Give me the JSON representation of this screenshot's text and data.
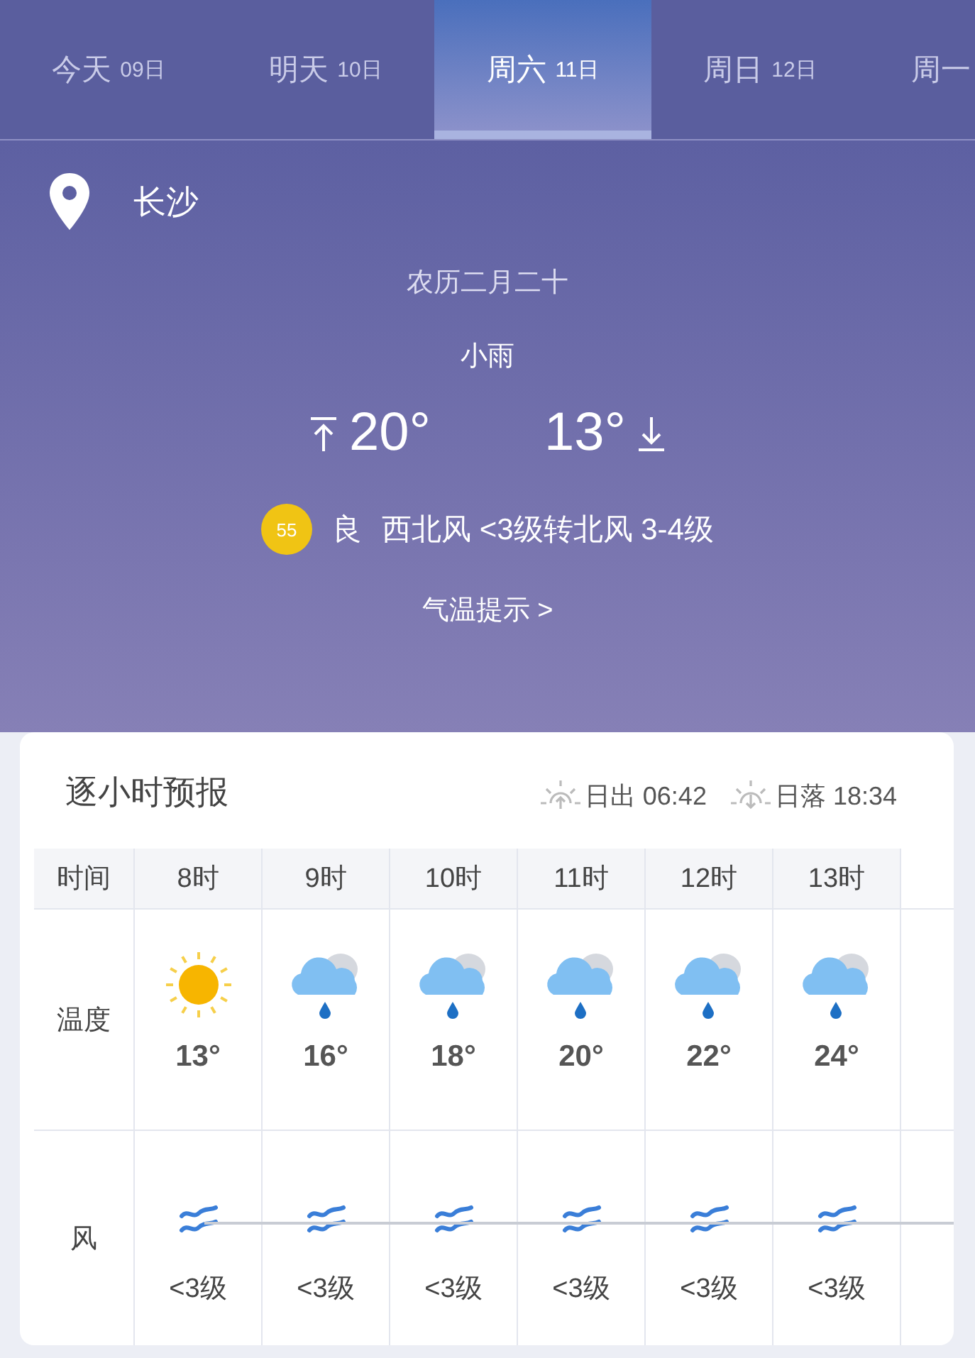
{
  "tabs": [
    {
      "day": "今天",
      "date": "09日",
      "selected": false
    },
    {
      "day": "明天",
      "date": "10日",
      "selected": false
    },
    {
      "day": "周六",
      "date": "11日",
      "selected": true
    },
    {
      "day": "周日",
      "date": "12日",
      "selected": false
    },
    {
      "day": "周一",
      "selected": false
    }
  ],
  "summary": {
    "city": "长沙",
    "lunar": "农历二月二十",
    "weather": "小雨",
    "high": "20°",
    "low": "13°",
    "aqi": {
      "value": "55",
      "color": "#f0c414"
    },
    "aqi_label": "良",
    "wind": "西北风 <3级转北风 3-4级",
    "tip": "气温提示 >"
  },
  "hourly": {
    "title": "逐小时预报",
    "sunrise": "日出 06:42",
    "sunset": "日落 18:34",
    "row_labels": [
      "时间",
      "温度",
      "风"
    ],
    "hours": [
      {
        "time": "8时",
        "kind": "sunny",
        "temp": "13°",
        "wind": "<3级"
      },
      {
        "time": "9时",
        "kind": "rain",
        "temp": "16°",
        "wind": "<3级"
      },
      {
        "time": "10时",
        "kind": "rain",
        "temp": "18°",
        "wind": "<3级"
      },
      {
        "time": "11时",
        "kind": "rain",
        "temp": "20°",
        "wind": "<3级"
      },
      {
        "time": "12时",
        "kind": "rain",
        "temp": "22°",
        "wind": "<3级"
      },
      {
        "time": "13时",
        "kind": "rain",
        "temp": "24°",
        "wind": "<3级"
      }
    ]
  }
}
